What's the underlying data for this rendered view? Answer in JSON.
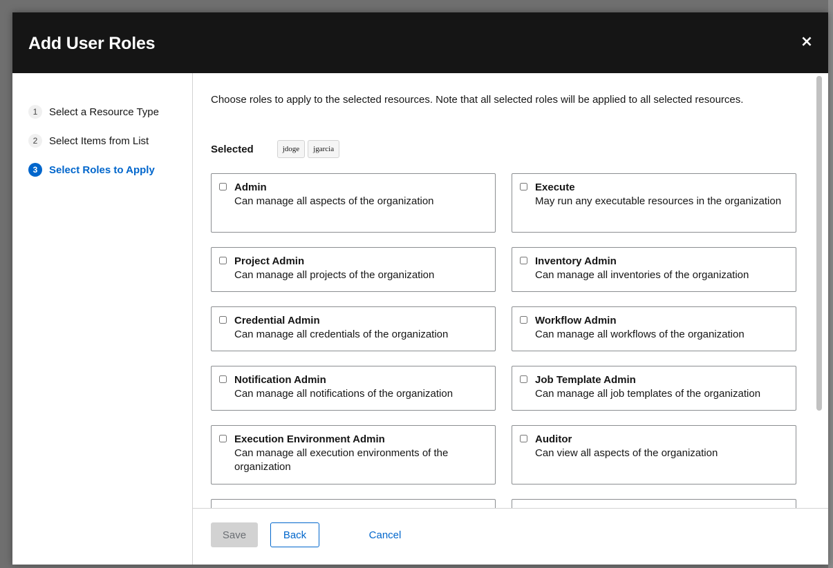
{
  "modal": {
    "title": "Add User Roles",
    "close_icon": "×"
  },
  "wizard_nav": {
    "steps": [
      {
        "number": "1",
        "label": "Select a Resource Type",
        "current": false
      },
      {
        "number": "2",
        "label": "Select Items from List",
        "current": false
      },
      {
        "number": "3",
        "label": "Select Roles to Apply",
        "current": true
      }
    ]
  },
  "content": {
    "description": "Choose roles to apply to the selected resources. Note that all selected roles will be applied to all selected resources.",
    "selected_label": "Selected",
    "selected_items": [
      "jdoge",
      "jgarcia"
    ]
  },
  "roles": [
    {
      "name": "Admin",
      "description": "Can manage all aspects of the organization",
      "checked": false
    },
    {
      "name": "Execute",
      "description": "May run any executable resources in the organization",
      "checked": false
    },
    {
      "name": "Project Admin",
      "description": "Can manage all projects of the organization",
      "checked": false
    },
    {
      "name": "Inventory Admin",
      "description": "Can manage all inventories of the organization",
      "checked": false
    },
    {
      "name": "Credential Admin",
      "description": "Can manage all credentials of the organization",
      "checked": false
    },
    {
      "name": "Workflow Admin",
      "description": "Can manage all workflows of the organization",
      "checked": false
    },
    {
      "name": "Notification Admin",
      "description": "Can manage all notifications of the organization",
      "checked": false
    },
    {
      "name": "Job Template Admin",
      "description": "Can manage all job templates of the organization",
      "checked": false
    },
    {
      "name": "Execution Environment Admin",
      "description": "Can manage all execution environments of the organization",
      "checked": false
    },
    {
      "name": "Auditor",
      "description": "Can view all aspects of the organization",
      "checked": false
    },
    {
      "name": "",
      "description": "",
      "checked": false
    },
    {
      "name": "",
      "description": "",
      "checked": false
    }
  ],
  "footer": {
    "save_label": "Save",
    "back_label": "Back",
    "cancel_label": "Cancel"
  },
  "icons": {
    "close": "close-icon",
    "checkbox": "checkbox-icon"
  },
  "colors": {
    "header_bg": "#151515",
    "accent": "#0066cc",
    "disabled_button": "#d2d2d2"
  }
}
